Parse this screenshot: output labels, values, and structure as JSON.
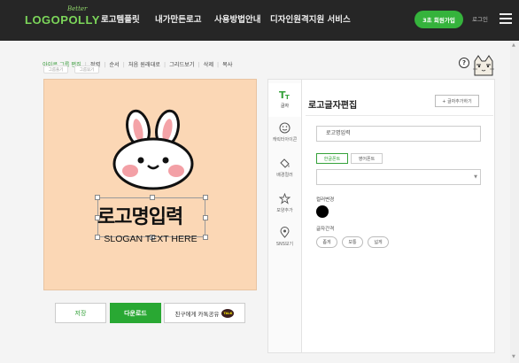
{
  "brand": {
    "name": "LOGOPOLLY",
    "tagline": "Better"
  },
  "nav": [
    {
      "label": "로고템플릿"
    },
    {
      "label": "내가만든로고"
    },
    {
      "label": "사용방법안내"
    },
    {
      "label": "디자인원격지원 서비스"
    }
  ],
  "header": {
    "signup": "3초 회원가입",
    "login": "로그인"
  },
  "toolbar": {
    "items": [
      "아이콘 그룹 편집",
      "정렬",
      "순서",
      "처음 원래대로",
      "그리드보기",
      "삭제",
      "복사"
    ],
    "small_buttons": [
      "그룹풀기",
      "그룹묶기"
    ]
  },
  "help": "?",
  "canvas": {
    "logo_text": "로고명입력",
    "slogan": "SLOGAN TEXT HERE",
    "background": "#fbd7b5"
  },
  "actions": {
    "save": "저장",
    "download": "다운로드",
    "share": "친구에게 카톡공유",
    "talk_badge": "TALK"
  },
  "panel": {
    "title": "로고글자편집",
    "add_text": "+ 글자추가하기",
    "sidebar": [
      {
        "label": "글자",
        "icon": "text-icon"
      },
      {
        "label": "캐릭터아이콘",
        "icon": "smiley-icon"
      },
      {
        "label": "배경컬러",
        "icon": "paint-bucket-icon"
      },
      {
        "label": "모양추가",
        "icon": "star-icon"
      },
      {
        "label": "SNS보기",
        "icon": "location-pin-icon"
      }
    ],
    "text_value": "로고명입력",
    "font_tabs": [
      "한글폰트",
      "영어폰트"
    ],
    "font_select": "",
    "color_label": "컬러변경",
    "color_value": "#000000",
    "spacing_label": "글자간격",
    "spacing_options": [
      "좁게",
      "보통",
      "넓게"
    ]
  },
  "colors": {
    "accent": "#35a23a",
    "topbar": "#262626"
  }
}
